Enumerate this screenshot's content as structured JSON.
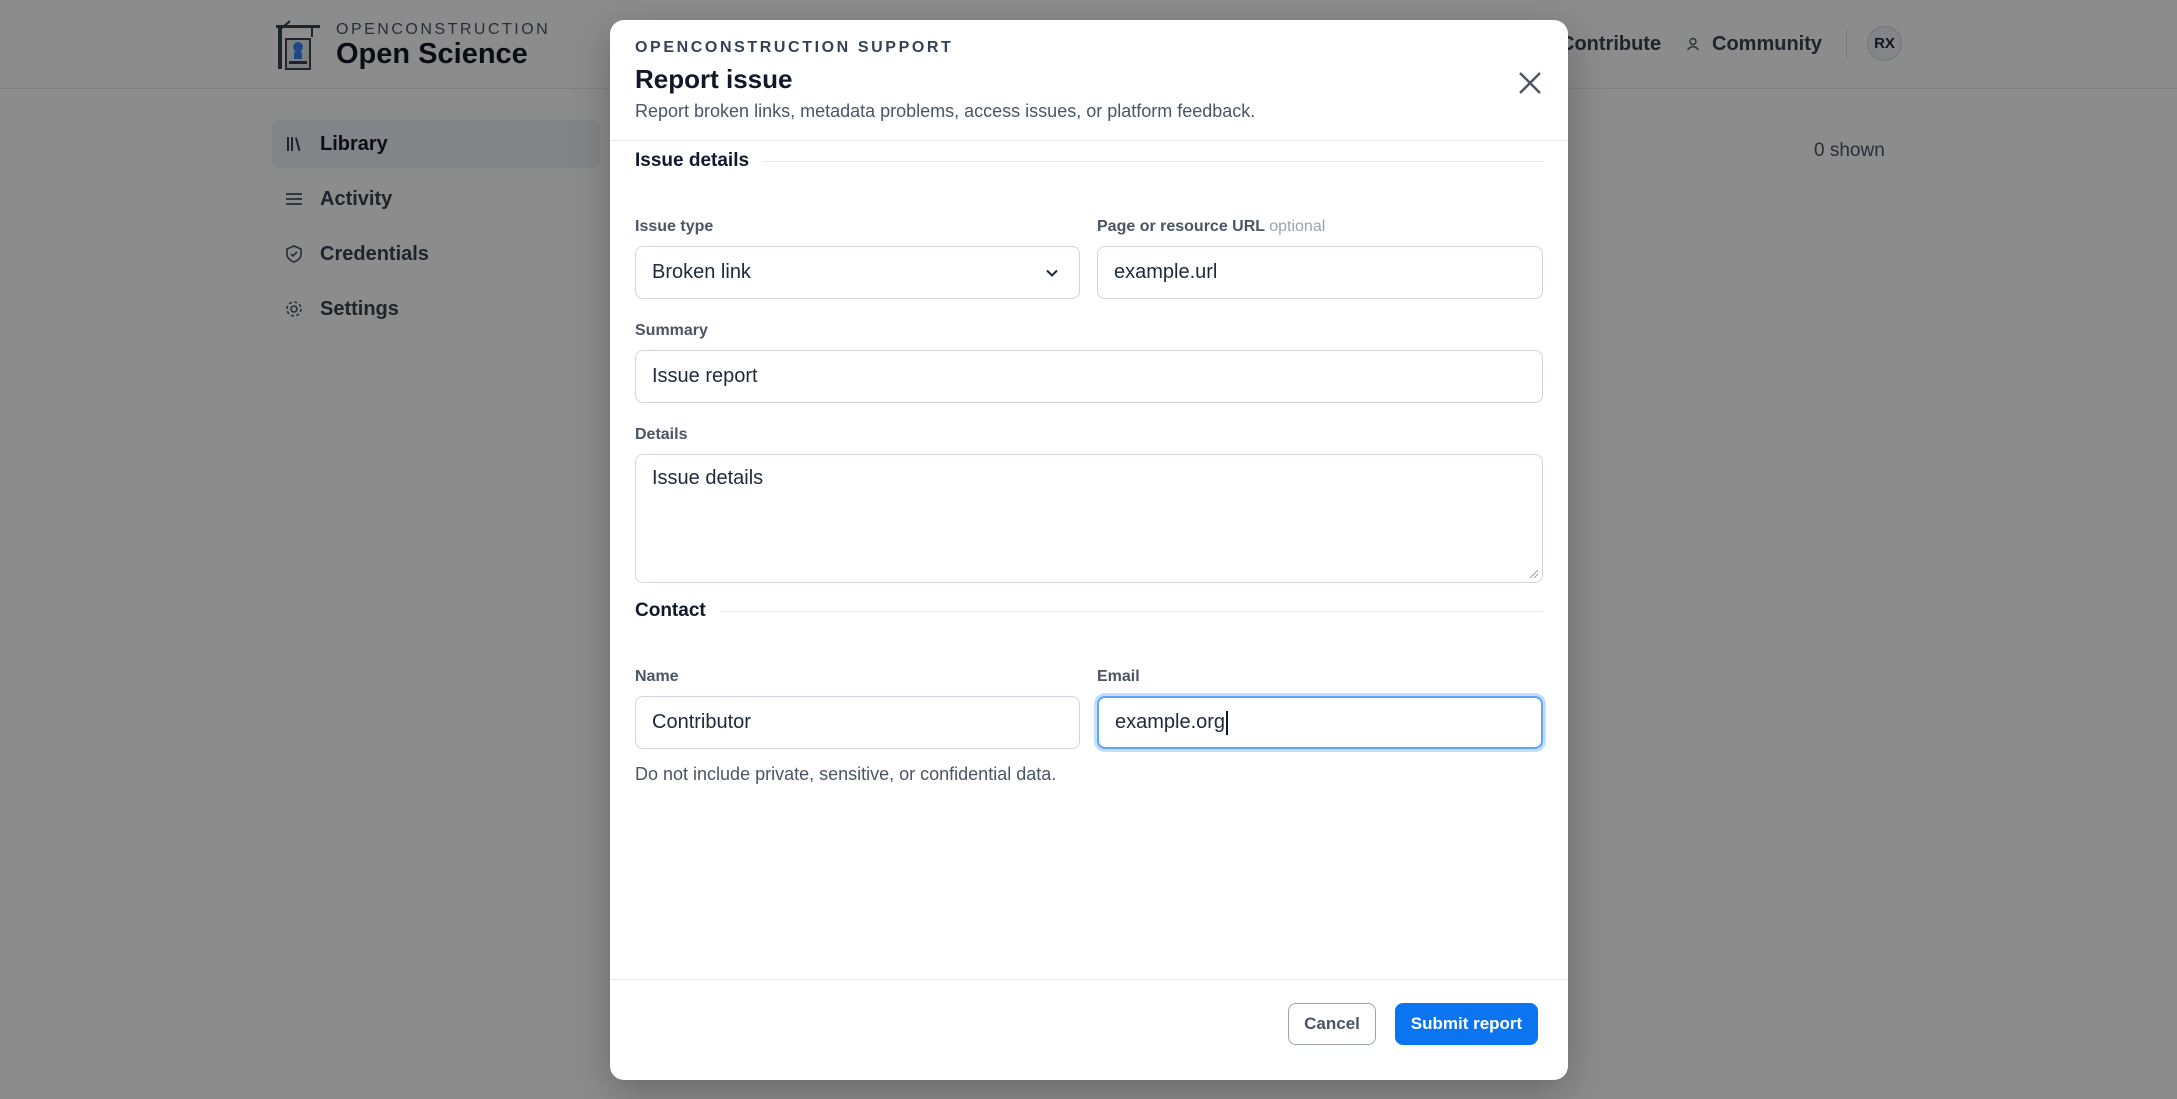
{
  "brand": {
    "kicker": "OPENCONSTRUCTION",
    "title": "Open Science",
    "logo_icon": "crane-building-logo-icon"
  },
  "topnav": {
    "contribute_label": "Contribute",
    "community_label": "Community",
    "community_icon": "person-icon",
    "avatar_initials": "RX"
  },
  "sidebar": {
    "items": [
      {
        "label": "Library",
        "icon": "library-icon",
        "active": true
      },
      {
        "label": "Activity",
        "icon": "list-icon",
        "active": false
      },
      {
        "label": "Credentials",
        "icon": "shield-icon",
        "active": false
      },
      {
        "label": "Settings",
        "icon": "gear-icon",
        "active": false
      }
    ]
  },
  "main": {
    "shown_count": "0 shown"
  },
  "modal": {
    "kicker": "OPENCONSTRUCTION SUPPORT",
    "title": "Report issue",
    "subtitle": "Report broken links, metadata problems, access issues, or platform feedback.",
    "sections": {
      "issue_details": "Issue details",
      "contact": "Contact"
    },
    "fields": {
      "issue_type": {
        "label": "Issue type",
        "value": "Broken link"
      },
      "page_url": {
        "label": "Page or resource URL",
        "optional_tag": "optional",
        "value": "example.url"
      },
      "summary": {
        "label": "Summary",
        "value": "Issue report"
      },
      "details": {
        "label": "Details",
        "value": "Issue details"
      },
      "name": {
        "label": "Name",
        "value": "Contributor"
      },
      "email": {
        "label": "Email",
        "value": "example.org"
      }
    },
    "hint": "Do not include private, sensitive, or confidential data.",
    "cancel_label": "Cancel",
    "submit_label": "Submit report"
  },
  "colors": {
    "accent": "#0b74f0",
    "focus_ring": "#60a5fa",
    "overlay": "rgba(0,0,0,0.45)"
  }
}
